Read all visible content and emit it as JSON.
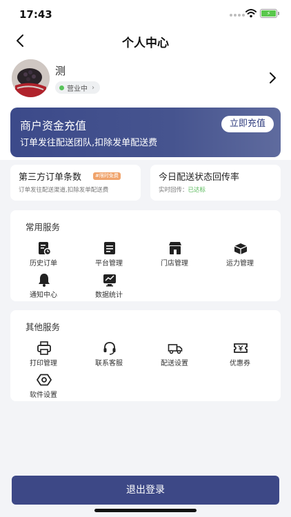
{
  "status_bar": {
    "time": "17:43",
    "battery_icon": "battery-charging-icon"
  },
  "nav": {
    "title": "个人中心",
    "back_icon": "chevron-left-icon"
  },
  "profile": {
    "store_name": "测",
    "status": "营业中",
    "status_color": "#58c35a",
    "arrow_icon": "chevron-right-icon"
  },
  "recharge": {
    "title": "商户资金充值",
    "description": "订单发往配送团队,扣除发单配送费",
    "button": "立即充值",
    "accent": "#3c4a8a"
  },
  "third_party": {
    "title": "第三方订单条数",
    "badge": "#限时免费",
    "description": "订单发往配送渠道,扣除发单配送费"
  },
  "delivery_rate": {
    "title": "今日配送状态回传率",
    "label": "实时回传：",
    "value": "已达标",
    "value_color": "#58b95a"
  },
  "common_services": {
    "title": "常用服务",
    "items": [
      {
        "label": "历史订单",
        "icon": "history-order-icon"
      },
      {
        "label": "平台管理",
        "icon": "platform-management-icon"
      },
      {
        "label": "门店管理",
        "icon": "store-icon"
      },
      {
        "label": "运力管理",
        "icon": "capacity-icon"
      },
      {
        "label": "通知中心",
        "icon": "bell-icon"
      },
      {
        "label": "数据统计",
        "icon": "chart-icon"
      }
    ]
  },
  "other_services": {
    "title": "其他服务",
    "items": [
      {
        "label": "打印管理",
        "icon": "printer-icon"
      },
      {
        "label": "联系客服",
        "icon": "headset-icon"
      },
      {
        "label": "配送设置",
        "icon": "truck-icon"
      },
      {
        "label": "优惠券",
        "icon": "coupon-icon"
      },
      {
        "label": "软件设置",
        "icon": "settings-icon"
      }
    ]
  },
  "logout": {
    "label": "退出登录",
    "color": "#3d4886"
  }
}
